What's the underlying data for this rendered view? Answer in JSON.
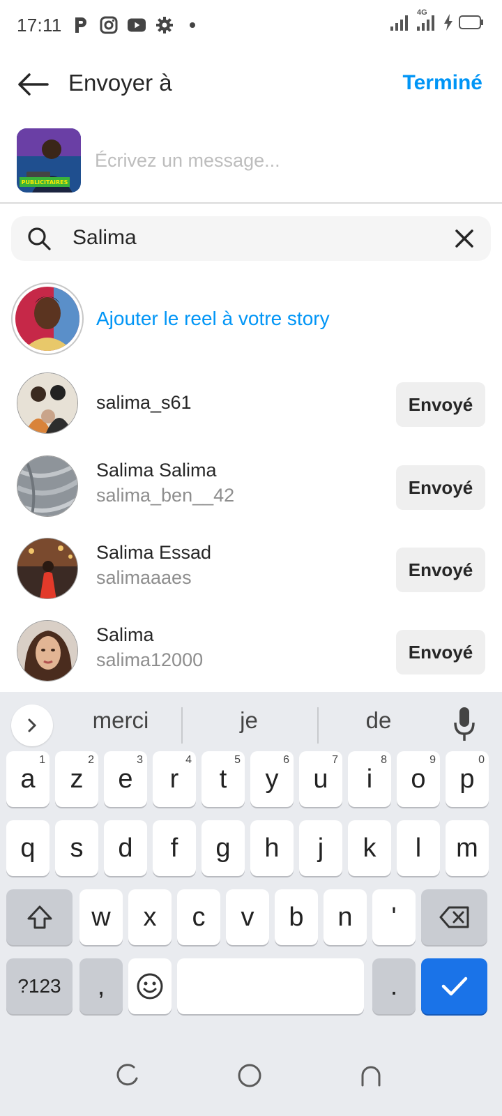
{
  "status_bar": {
    "time": "17:11",
    "left_icons": [
      "p-icon",
      "instagram-icon",
      "youtube-icon",
      "settings-icon",
      "dot-icon"
    ],
    "network": "4G"
  },
  "header": {
    "title": "Envoyer à",
    "done_label": "Terminé",
    "accent_color": "#0095f6"
  },
  "message": {
    "placeholder": "Écrivez un message...",
    "thumbnail_text": "PUBLICITAIRES"
  },
  "search": {
    "value": "Salima"
  },
  "story": {
    "label": "Ajouter le reel à votre story"
  },
  "contacts": [
    {
      "name": "salima_s61",
      "username": "",
      "status": "Envoyé"
    },
    {
      "name": "Salima Salima",
      "username": "salima_ben__42",
      "status": "Envoyé"
    },
    {
      "name": "Salima Essad",
      "username": "salimaaaes",
      "status": "Envoyé"
    },
    {
      "name": "Salima",
      "username": "salima12000",
      "status": "Envoyé"
    }
  ],
  "keyboard": {
    "suggestions": [
      "merci",
      "je",
      "de"
    ],
    "row1": [
      {
        "k": "a",
        "n": "1"
      },
      {
        "k": "z",
        "n": "2"
      },
      {
        "k": "e",
        "n": "3"
      },
      {
        "k": "r",
        "n": "4"
      },
      {
        "k": "t",
        "n": "5"
      },
      {
        "k": "y",
        "n": "6"
      },
      {
        "k": "u",
        "n": "7"
      },
      {
        "k": "i",
        "n": "8"
      },
      {
        "k": "o",
        "n": "9"
      },
      {
        "k": "p",
        "n": "0"
      }
    ],
    "row2": [
      "q",
      "s",
      "d",
      "f",
      "g",
      "h",
      "j",
      "k",
      "l",
      "m"
    ],
    "row3": [
      "w",
      "x",
      "c",
      "v",
      "b",
      "n",
      "'"
    ],
    "symbols_label": "?123",
    "comma": ",",
    "period": "."
  }
}
